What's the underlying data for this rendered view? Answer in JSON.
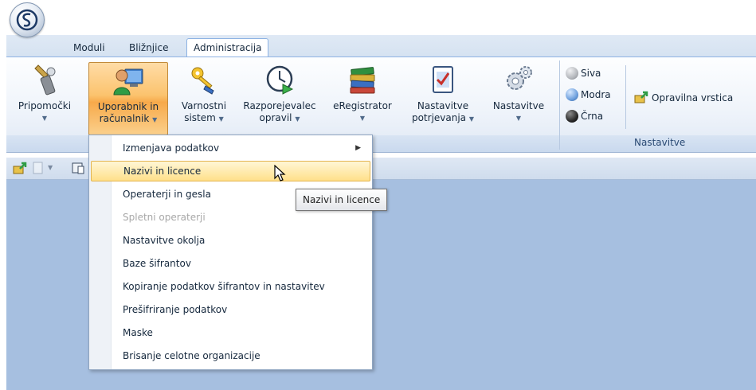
{
  "app": {
    "logo": "app-orb-logo"
  },
  "tabs": [
    {
      "label": "Moduli",
      "active": false
    },
    {
      "label": "Bližnjice",
      "active": false
    },
    {
      "label": "Administracija",
      "active": true
    }
  ],
  "ribbon": {
    "buttons": [
      {
        "line1": "Pripomočki",
        "line2": "",
        "icon": "tools-icon"
      },
      {
        "line1": "Uporabnik in",
        "line2": "računalnik",
        "icon": "user-computer-icon",
        "pressed": true
      },
      {
        "line1": "Varnostni",
        "line2": "sistem",
        "icon": "keys-icon"
      },
      {
        "line1": "Razporejevalec",
        "line2": "opravil",
        "icon": "scheduler-clock-icon"
      },
      {
        "line1": "eRegistrator",
        "line2": "",
        "icon": "books-icon"
      },
      {
        "line1": "Nastavitve",
        "line2": "potrjevanja",
        "icon": "checklist-icon"
      },
      {
        "line1": "Nastavitve",
        "line2": "",
        "icon": "gears-icon"
      }
    ],
    "theme_options": [
      {
        "label": "Siva",
        "color": "#b5b8bd"
      },
      {
        "label": "Modra",
        "color": "#6ea0dd"
      },
      {
        "label": "Črna",
        "color": "#2a2a2a"
      }
    ],
    "taskbar_button": "Opravilna vrstica",
    "group_caption": "Nastavitve"
  },
  "menu": {
    "items": [
      {
        "label": "Izmenjava podatkov",
        "submenu": true
      },
      {
        "label": "Nazivi in licence",
        "hover": true
      },
      {
        "label": "Operaterji in gesla"
      },
      {
        "label": "Spletni operaterji",
        "disabled": true
      },
      {
        "label": "Nastavitve okolja"
      },
      {
        "label": "Baze šifrantov"
      },
      {
        "label": "Kopiranje podatkov šifrantov in nastavitev"
      },
      {
        "label": "Prešifriranje podatkov"
      },
      {
        "label": "Maske"
      },
      {
        "label": "Brisanje celotne organizacije"
      }
    ]
  },
  "tooltip": "Nazivi in licence",
  "colors": {
    "accent_orange": "#f7a94a",
    "workspace": "#a6bfe0",
    "ribbon_border": "#8db2e3"
  }
}
